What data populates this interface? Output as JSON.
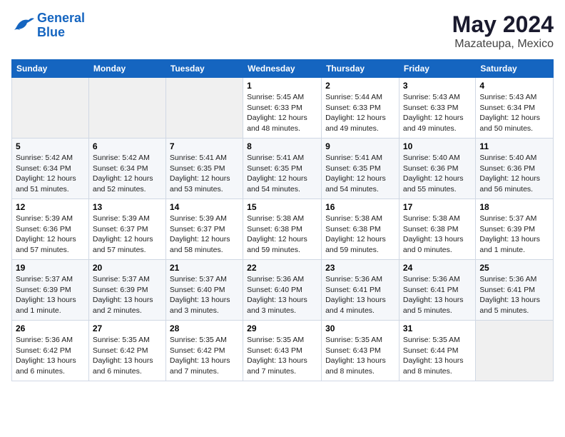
{
  "header": {
    "logo_line1": "General",
    "logo_line2": "Blue",
    "month": "May 2024",
    "location": "Mazateupa, Mexico"
  },
  "weekdays": [
    "Sunday",
    "Monday",
    "Tuesday",
    "Wednesday",
    "Thursday",
    "Friday",
    "Saturday"
  ],
  "weeks": [
    [
      {
        "day": "",
        "empty": true
      },
      {
        "day": "",
        "empty": true
      },
      {
        "day": "",
        "empty": true
      },
      {
        "day": "1",
        "sunrise": "5:45 AM",
        "sunset": "6:33 PM",
        "daylight": "12 hours and 48 minutes."
      },
      {
        "day": "2",
        "sunrise": "5:44 AM",
        "sunset": "6:33 PM",
        "daylight": "12 hours and 49 minutes."
      },
      {
        "day": "3",
        "sunrise": "5:43 AM",
        "sunset": "6:33 PM",
        "daylight": "12 hours and 49 minutes."
      },
      {
        "day": "4",
        "sunrise": "5:43 AM",
        "sunset": "6:34 PM",
        "daylight": "12 hours and 50 minutes."
      }
    ],
    [
      {
        "day": "5",
        "sunrise": "5:42 AM",
        "sunset": "6:34 PM",
        "daylight": "12 hours and 51 minutes."
      },
      {
        "day": "6",
        "sunrise": "5:42 AM",
        "sunset": "6:34 PM",
        "daylight": "12 hours and 52 minutes."
      },
      {
        "day": "7",
        "sunrise": "5:41 AM",
        "sunset": "6:35 PM",
        "daylight": "12 hours and 53 minutes."
      },
      {
        "day": "8",
        "sunrise": "5:41 AM",
        "sunset": "6:35 PM",
        "daylight": "12 hours and 54 minutes."
      },
      {
        "day": "9",
        "sunrise": "5:41 AM",
        "sunset": "6:35 PM",
        "daylight": "12 hours and 54 minutes."
      },
      {
        "day": "10",
        "sunrise": "5:40 AM",
        "sunset": "6:36 PM",
        "daylight": "12 hours and 55 minutes."
      },
      {
        "day": "11",
        "sunrise": "5:40 AM",
        "sunset": "6:36 PM",
        "daylight": "12 hours and 56 minutes."
      }
    ],
    [
      {
        "day": "12",
        "sunrise": "5:39 AM",
        "sunset": "6:36 PM",
        "daylight": "12 hours and 57 minutes."
      },
      {
        "day": "13",
        "sunrise": "5:39 AM",
        "sunset": "6:37 PM",
        "daylight": "12 hours and 57 minutes."
      },
      {
        "day": "14",
        "sunrise": "5:39 AM",
        "sunset": "6:37 PM",
        "daylight": "12 hours and 58 minutes."
      },
      {
        "day": "15",
        "sunrise": "5:38 AM",
        "sunset": "6:38 PM",
        "daylight": "12 hours and 59 minutes."
      },
      {
        "day": "16",
        "sunrise": "5:38 AM",
        "sunset": "6:38 PM",
        "daylight": "12 hours and 59 minutes."
      },
      {
        "day": "17",
        "sunrise": "5:38 AM",
        "sunset": "6:38 PM",
        "daylight": "13 hours and 0 minutes."
      },
      {
        "day": "18",
        "sunrise": "5:37 AM",
        "sunset": "6:39 PM",
        "daylight": "13 hours and 1 minute."
      }
    ],
    [
      {
        "day": "19",
        "sunrise": "5:37 AM",
        "sunset": "6:39 PM",
        "daylight": "13 hours and 1 minute."
      },
      {
        "day": "20",
        "sunrise": "5:37 AM",
        "sunset": "6:39 PM",
        "daylight": "13 hours and 2 minutes."
      },
      {
        "day": "21",
        "sunrise": "5:37 AM",
        "sunset": "6:40 PM",
        "daylight": "13 hours and 3 minutes."
      },
      {
        "day": "22",
        "sunrise": "5:36 AM",
        "sunset": "6:40 PM",
        "daylight": "13 hours and 3 minutes."
      },
      {
        "day": "23",
        "sunrise": "5:36 AM",
        "sunset": "6:41 PM",
        "daylight": "13 hours and 4 minutes."
      },
      {
        "day": "24",
        "sunrise": "5:36 AM",
        "sunset": "6:41 PM",
        "daylight": "13 hours and 5 minutes."
      },
      {
        "day": "25",
        "sunrise": "5:36 AM",
        "sunset": "6:41 PM",
        "daylight": "13 hours and 5 minutes."
      }
    ],
    [
      {
        "day": "26",
        "sunrise": "5:36 AM",
        "sunset": "6:42 PM",
        "daylight": "13 hours and 6 minutes."
      },
      {
        "day": "27",
        "sunrise": "5:35 AM",
        "sunset": "6:42 PM",
        "daylight": "13 hours and 6 minutes."
      },
      {
        "day": "28",
        "sunrise": "5:35 AM",
        "sunset": "6:42 PM",
        "daylight": "13 hours and 7 minutes."
      },
      {
        "day": "29",
        "sunrise": "5:35 AM",
        "sunset": "6:43 PM",
        "daylight": "13 hours and 7 minutes."
      },
      {
        "day": "30",
        "sunrise": "5:35 AM",
        "sunset": "6:43 PM",
        "daylight": "13 hours and 8 minutes."
      },
      {
        "day": "31",
        "sunrise": "5:35 AM",
        "sunset": "6:44 PM",
        "daylight": "13 hours and 8 minutes."
      },
      {
        "day": "",
        "empty": true
      }
    ]
  ]
}
